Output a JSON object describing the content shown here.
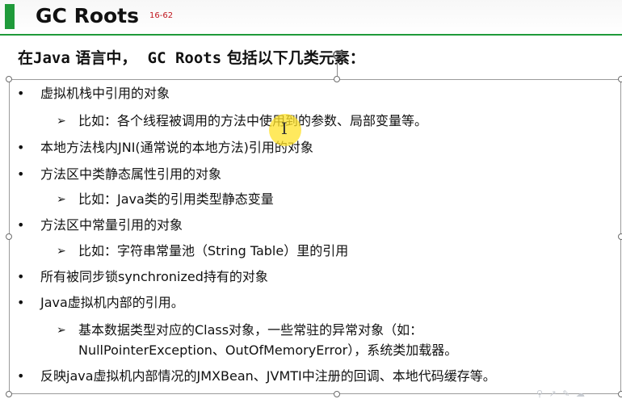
{
  "slide": {
    "title": "GC Roots",
    "page_marker": "16-62",
    "intro": {
      "prefix": "在",
      "java": "Java",
      "middle": " 语言中，  ",
      "gc_roots": "GC Roots",
      "suffix": " 包括以下几类元素："
    }
  },
  "items": [
    {
      "kind": "bullet",
      "text": "虚拟机栈中引用的对象"
    },
    {
      "kind": "sub",
      "text": "比如：各个线程被调用的方法中使用到的参数、局部变量等。"
    },
    {
      "kind": "bullet",
      "text": "本地方法栈内JNI(通常说的本地方法)引用的对象"
    },
    {
      "kind": "bullet",
      "text": "方法区中类静态属性引用的对象"
    },
    {
      "kind": "sub",
      "text": "比如：Java类的引用类型静态变量"
    },
    {
      "kind": "bullet",
      "text": "方法区中常量引用的对象"
    },
    {
      "kind": "sub",
      "text": "比如：字符串常量池（String Table）里的引用"
    },
    {
      "kind": "bullet",
      "text": "所有被同步锁synchronized持有的对象"
    },
    {
      "kind": "bullet",
      "text": "Java虚拟机内部的引用。"
    },
    {
      "kind": "sub",
      "text": "基本数据类型对应的Class对象，一些常驻的异常对象（如："
    },
    {
      "kind": "sub-cont",
      "text": "NullPointerException、OutOfMemoryError），系统类加载器。"
    },
    {
      "kind": "bullet",
      "text": "反映java虚拟机内部情况的JMXBean、JVMTI中注册的回调、本地代码缓存等。"
    }
  ],
  "symbols": {
    "bullet": "•",
    "arrow": "➢",
    "ibeam": "I"
  },
  "icons": {
    "cursor": "ibeam-cursor-icon",
    "rotate": "rotate-handle-icon"
  },
  "colors": {
    "accent": "#1f9a3a",
    "page_marker": "#c0161e",
    "cursor_highlight": "#ffe228"
  },
  "watermark": "⚲ ↗ ✎ ☁"
}
